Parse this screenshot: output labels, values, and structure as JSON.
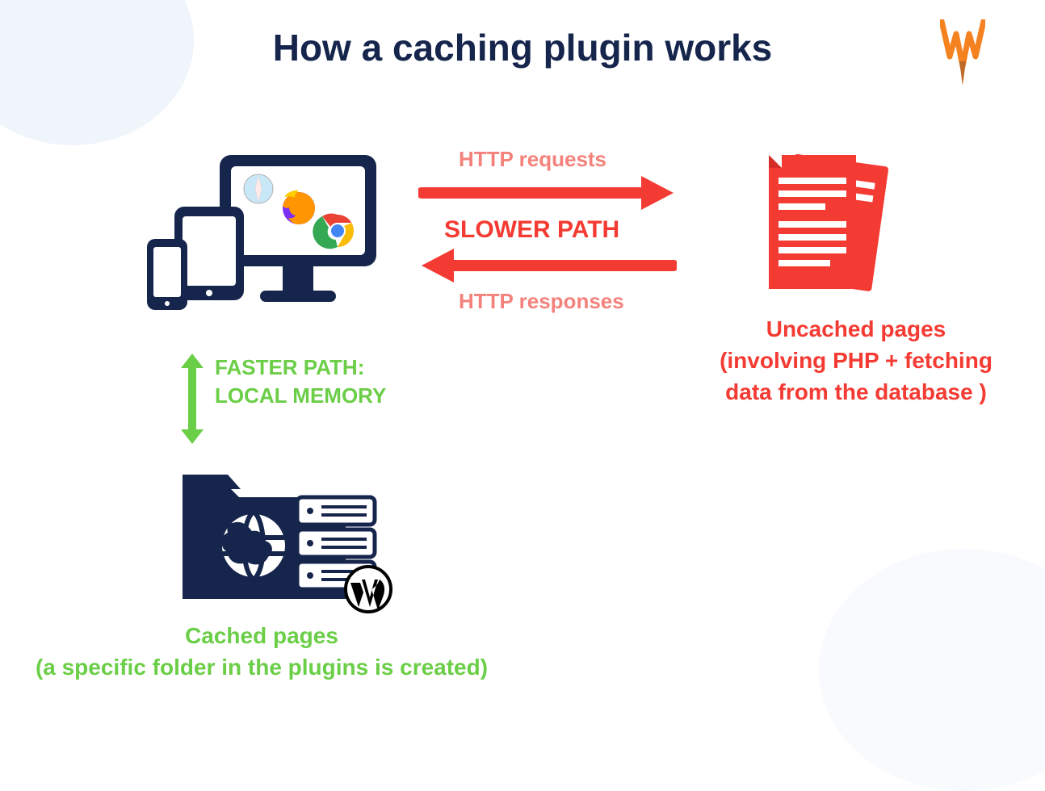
{
  "title": "How a caching plugin works",
  "labels": {
    "http_requests": "HTTP requests",
    "slower_path": "SLOWER PATH",
    "http_responses": "HTTP responses",
    "uncached_heading": "Uncached pages",
    "uncached_sub": "(involving PHP + fetching data from the database )",
    "faster_line1": "FASTER PATH:",
    "faster_line2": "LOCAL MEMORY",
    "cached_heading": "Cached pages",
    "cached_sub": "(a specific folder in the plugins is created)"
  },
  "colors": {
    "navy": "#16254c",
    "red": "#f43b33",
    "red_light": "#f4827c",
    "green": "#6bce47",
    "orange": "#f58220"
  }
}
